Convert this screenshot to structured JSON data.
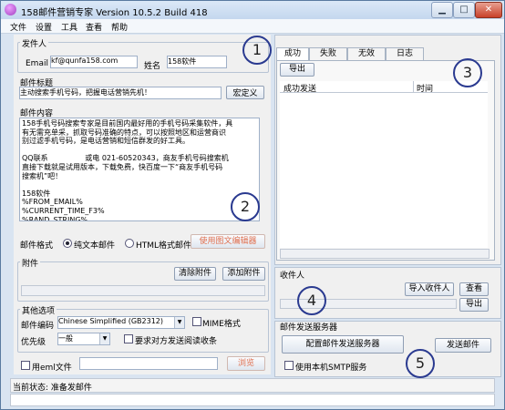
{
  "title": "158邮件营销专家 Version 10.5.2 Build 418",
  "menu": [
    "文件",
    "设置",
    "工具",
    "查看",
    "帮助"
  ],
  "sender": {
    "label": "发件人",
    "email_label": "Email",
    "email_value": "kf@qunfa158.com",
    "name_label": "姓名",
    "name_value": "158软件"
  },
  "subject": {
    "label": "邮件标题",
    "value": "主动搜索手机号码，把握电话营销先机！",
    "custom_button": "宏定义"
  },
  "content": {
    "label": "邮件内容",
    "lines": [
      "158手机号码搜索专家是目前国内最好用的手机号码采集软件，具",
      "有无需充单采，抓取号码准确的特点，可以按照地区和运营商识",
      "别过滤手机号码，是电话营销和短信群发的好工具。",
      "",
      "QQ联系                或电 021-60520343，商友手机号码搜索机",
      "直接下载就是试用版本，下载免费，快百度一下“商友手机号码",
      "搜索机”吧！",
      "",
      "158软件",
      "%FROM_EMAIL%",
      "%CURRENT_TIME_F3%",
      "%RAND_STRING%"
    ]
  },
  "format": {
    "label": "邮件格式",
    "options": [
      "纯文本邮件",
      "HTML格式邮件"
    ],
    "selected": "纯文本邮件",
    "editor_button": "使用图文编辑器"
  },
  "attachment": {
    "label": "附件",
    "clear_button": "清除附件",
    "add_button": "添加附件"
  },
  "other": {
    "label": "其他选项",
    "encoding_label": "邮件编码",
    "encoding_value": "Chinese Simplified (GB2312)",
    "mime_label": "MIME格式",
    "priority_label": "优先级",
    "priority_value": "一般",
    "receipt_label": "要求对方发送阅读收条"
  },
  "eml": {
    "label": "用eml文件",
    "browse_button": "浏览"
  },
  "tabs": [
    "成功",
    "失败",
    "无效",
    "日志"
  ],
  "active_tab": "成功",
  "export_button": "导出",
  "table": {
    "columns": [
      "成功发送",
      "时间"
    ]
  },
  "recipients": {
    "label": "收件人",
    "import_button": "导入收件人",
    "view_button": "查看",
    "export_button": "导出"
  },
  "smtp": {
    "label": "邮件发送服务器",
    "config_button": "配置邮件发送服务器",
    "send_button": "发送邮件",
    "use_local_label": "使用本机SMTP服务"
  },
  "status": {
    "text": "当前状态: 准备发邮件"
  },
  "markers": [
    "1",
    "2",
    "3",
    "4",
    "5"
  ]
}
